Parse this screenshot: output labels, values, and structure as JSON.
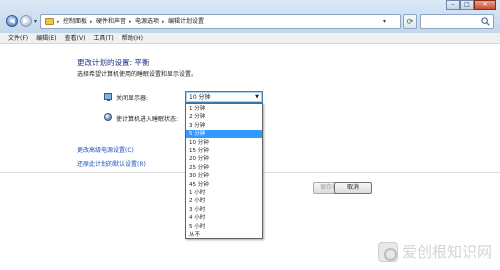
{
  "nav": {
    "back_glyph": "◀",
    "forward_glyph": "▶",
    "dropdown_glyph": "▾"
  },
  "breadcrumb": {
    "separator": "▸",
    "items": [
      "控制面板",
      "硬件和声音",
      "电源选项",
      "编辑计划设置"
    ]
  },
  "window_controls": {
    "minimize": "–",
    "maximize": "□",
    "close": "✕"
  },
  "menubar": {
    "items": [
      "文件(F)",
      "编辑(E)",
      "查看(V)",
      "工具(T)",
      "帮助(H)"
    ]
  },
  "page": {
    "title": "更改计划的设置: 平衡",
    "subtitle": "选择希望计算机使用的睡眠设置和显示设置。"
  },
  "settings": {
    "display_label": "关闭显示器:",
    "sleep_label": "使计算机进入睡眠状态:"
  },
  "dropdown": {
    "selected_value": "10 分钟",
    "arrow": "▼",
    "highlighted_option": "5 分钟",
    "options": [
      "1 分钟",
      "2 分钟",
      "3 分钟",
      "5 分钟",
      "10 分钟",
      "15 分钟",
      "20 分钟",
      "25 分钟",
      "30 分钟",
      "45 分钟",
      "1 小时",
      "2 小时",
      "3 小时",
      "4 小时",
      "5 小时",
      "从不"
    ]
  },
  "links": {
    "advanced": "更改高级电源设置(C)",
    "restore": "还原此计划的默认设置(R)"
  },
  "buttons": {
    "save": "保存修改",
    "cancel": "取消"
  },
  "watermark": {
    "text": "爱创根知识网"
  },
  "colors": {
    "accent_link": "#1a55c0",
    "title_blue": "#1e3287",
    "selection": "#3399ff"
  }
}
